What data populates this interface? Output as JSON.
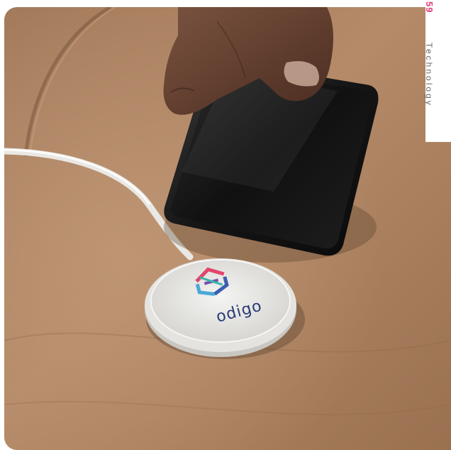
{
  "header": {
    "page_number": "59",
    "section": "Technology"
  },
  "product": {
    "brand": "odigo"
  },
  "colors": {
    "accent": "#e23b7a",
    "brand_text": "#2a3a78"
  }
}
